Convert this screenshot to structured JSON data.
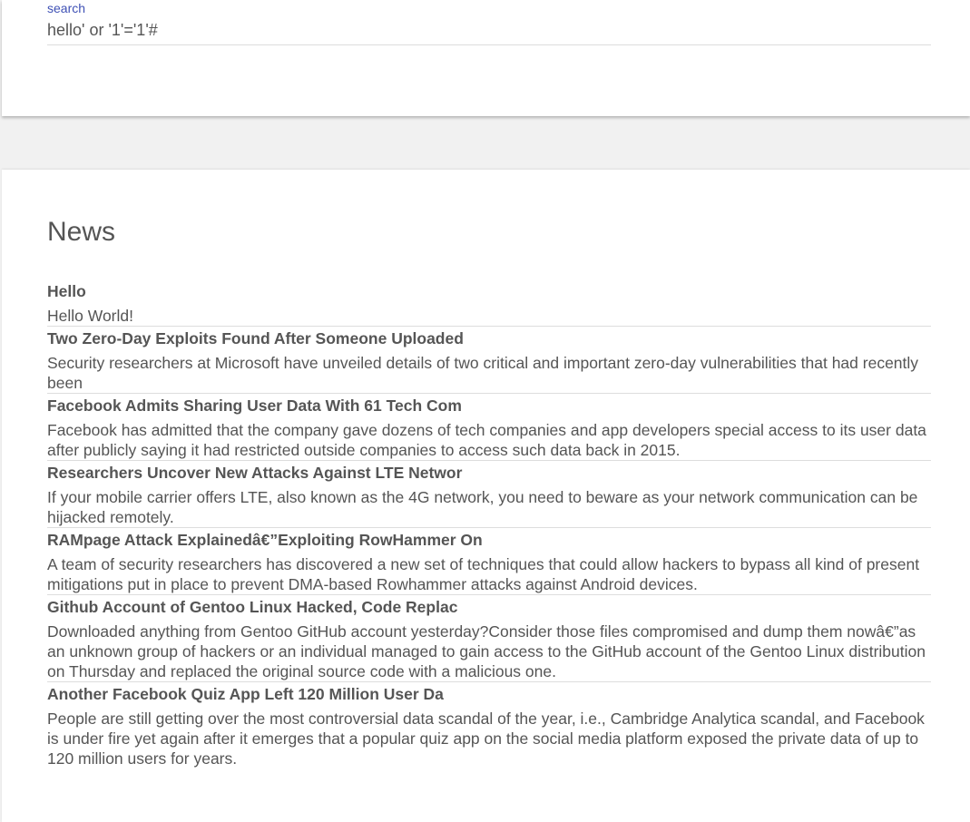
{
  "search": {
    "label": "search",
    "value": "hello' or '1'='1'#"
  },
  "news": {
    "heading": "News",
    "items": [
      {
        "title": "Hello",
        "body": "Hello World!"
      },
      {
        "title": "Two Zero-Day Exploits Found After Someone Uploaded",
        "body": "Security researchers at Microsoft have unveiled details of two critical and important zero-day vulnerabilities that had recently been"
      },
      {
        "title": "Facebook Admits Sharing User Data With 61 Tech Com",
        "body": "Facebook has admitted that the company gave dozens of tech companies and app developers special access to its user data after publicly saying it had restricted outside companies to access such data back in 2015."
      },
      {
        "title": "Researchers Uncover New Attacks Against LTE Networ",
        "body": "If your mobile carrier offers LTE, also known as the 4G network, you need to beware as your network communication can be hijacked remotely."
      },
      {
        "title": "RAMpage Attack Explainedâ€”Exploiting RowHammer On",
        "body": "A team of security researchers has discovered a new set of techniques that could allow hackers to bypass all kind of present mitigations put in place to prevent DMA-based Rowhammer attacks against Android devices."
      },
      {
        "title": "Github Account of Gentoo Linux Hacked, Code Replac",
        "body": "Downloaded anything from Gentoo GitHub account yesterday?Consider those files compromised and dump them nowâ€”as an unknown group of hackers or an individual managed to gain access to the GitHub account of the Gentoo Linux distribution on Thursday and replaced the original source code with a malicious one."
      },
      {
        "title": "Another Facebook Quiz App Left 120 Million User Da",
        "body": "People are still getting over the most controversial data scandal of the year, i.e., Cambridge Analytica scandal, and Facebook is under fire yet again after it emerges that a popular quiz app on the social media platform exposed the private data of up to 120 million users for years."
      }
    ]
  }
}
